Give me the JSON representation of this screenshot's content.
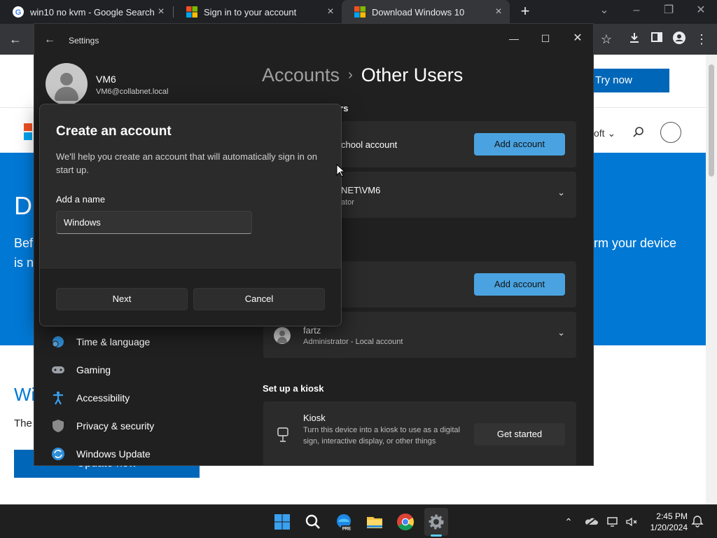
{
  "browser": {
    "tabs": [
      {
        "title": "win10 no kvm - Google Search"
      },
      {
        "title": "Sign in to your account"
      },
      {
        "title": "Download Windows 10"
      }
    ]
  },
  "webpage": {
    "try_now": "Try now",
    "nav_text": "oft",
    "hero_heading": "D",
    "hero_text_left_1": "Bef",
    "hero_text_left_2": "is n",
    "hero_text_right": "rm your device",
    "section_heading": "Wi",
    "section_text": "The",
    "update_button": "Update now"
  },
  "settings": {
    "window_title": "Settings",
    "user": {
      "name": "VM6",
      "email": "VM6@collabnet.local"
    },
    "breadcrumb": {
      "parent": "Accounts",
      "separator": "›",
      "current": "Other Users"
    },
    "section1_header_fragment": "ers",
    "card1_text": "chool account",
    "add_account_label": "Add account",
    "card2_title": "NET\\VM6",
    "card2_sub": "ator",
    "user2": {
      "name": "fartz",
      "role": "Administrator - Local account"
    },
    "kiosk": {
      "section_header": "Set up a kiosk",
      "title": "Kiosk",
      "description": "Turn this device into a kiosk to use as a digital sign, interactive display, or other things",
      "button": "Get started"
    },
    "nav_items": [
      {
        "label": "Time & language",
        "icon": "globe-clock-icon"
      },
      {
        "label": "Gaming",
        "icon": "gamepad-icon"
      },
      {
        "label": "Accessibility",
        "icon": "accessibility-icon"
      },
      {
        "label": "Privacy & security",
        "icon": "shield-icon"
      },
      {
        "label": "Windows Update",
        "icon": "sync-icon"
      }
    ]
  },
  "dialog": {
    "title": "Create an account",
    "description": "We'll help you create an account that will automatically sign in on start up.",
    "name_label": "Add a name",
    "name_value": "Windows",
    "next_button": "Next",
    "cancel_button": "Cancel"
  },
  "taskbar": {
    "time": "2:45 PM",
    "date": "1/20/2024",
    "edge_badge": "PRE"
  },
  "colors": {
    "accent_blue": "#4aa3e0",
    "hero_blue": "#0078d4",
    "settings_bg": "#202020",
    "card_bg": "#2b2b2b"
  }
}
